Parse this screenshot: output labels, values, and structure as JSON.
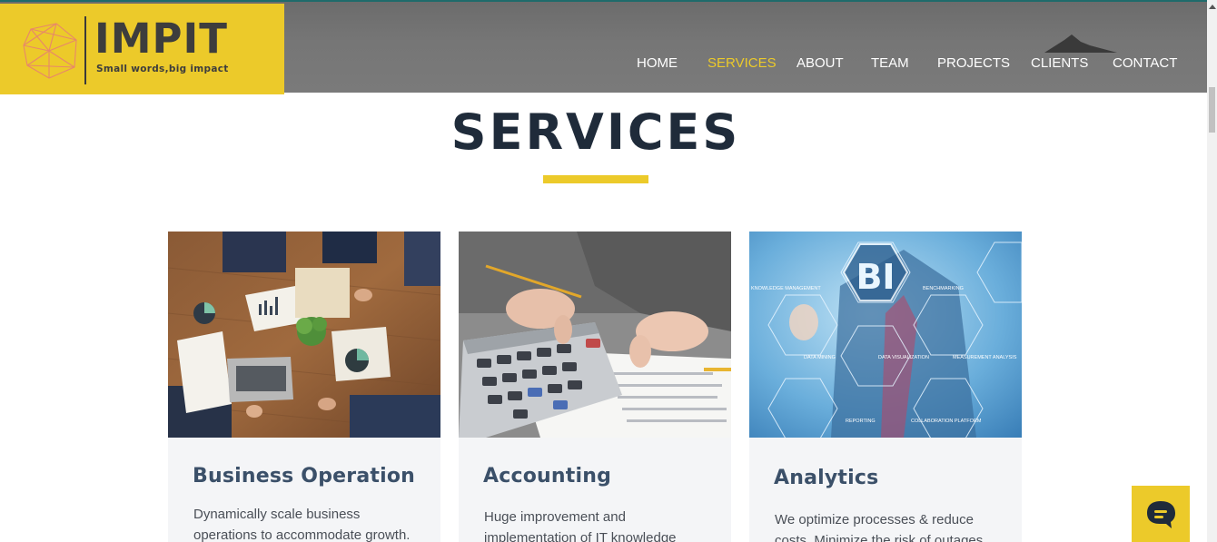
{
  "header": {
    "logo": {
      "title": "IMPIT",
      "tagline": "Small words,big impact"
    },
    "nav": [
      {
        "label": "HOME",
        "active": false
      },
      {
        "label": "SERVICES",
        "active": true
      },
      {
        "label": "ABOUT",
        "active": false
      },
      {
        "label": "TEAM",
        "active": false
      },
      {
        "label": "PROJECTS",
        "active": false
      },
      {
        "label": "CLIENTS",
        "active": false
      },
      {
        "label": "CONTACT",
        "active": false
      }
    ]
  },
  "section": {
    "title": "SERVICES",
    "cards": [
      {
        "title": "Business Operation",
        "text": "Dynamically scale business operations to accommodate growth."
      },
      {
        "title": "Accounting",
        "text": "Huge improvement and implementation of IT knowledge"
      },
      {
        "title": "Analytics",
        "text": "We optimize processes & reduce costs. Minimize the risk of outages"
      }
    ]
  },
  "analytics_image_labels": {
    "bi": "BI",
    "labels": [
      "KNOWLEDGE MANAGEMENT",
      "BENCHMARKING",
      "DATA MINING",
      "DATA VISUALIZATION",
      "MEASUREMENT ANALYSIS",
      "REPORTING",
      "COLLABORATION PLATFORM"
    ]
  },
  "colors": {
    "accent": "#ecca2a",
    "header_bg": "#767676",
    "title": "#1f2b3a",
    "card_title": "#3b5069",
    "card_bg": "#f4f5f7"
  },
  "icons": {
    "logo": "polygon-gem-logo",
    "chat": "chat-bubble-icon"
  }
}
